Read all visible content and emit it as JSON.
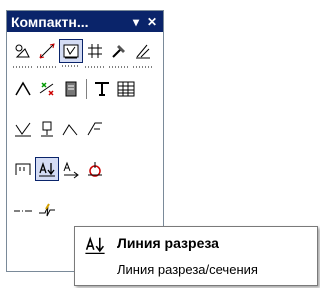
{
  "window": {
    "title": "Компактн...",
    "menu_glyph": "▾",
    "close_glyph": "✕"
  },
  "tooltip": {
    "title": "Линия разреза",
    "description": "Линия разреза/сечения"
  }
}
